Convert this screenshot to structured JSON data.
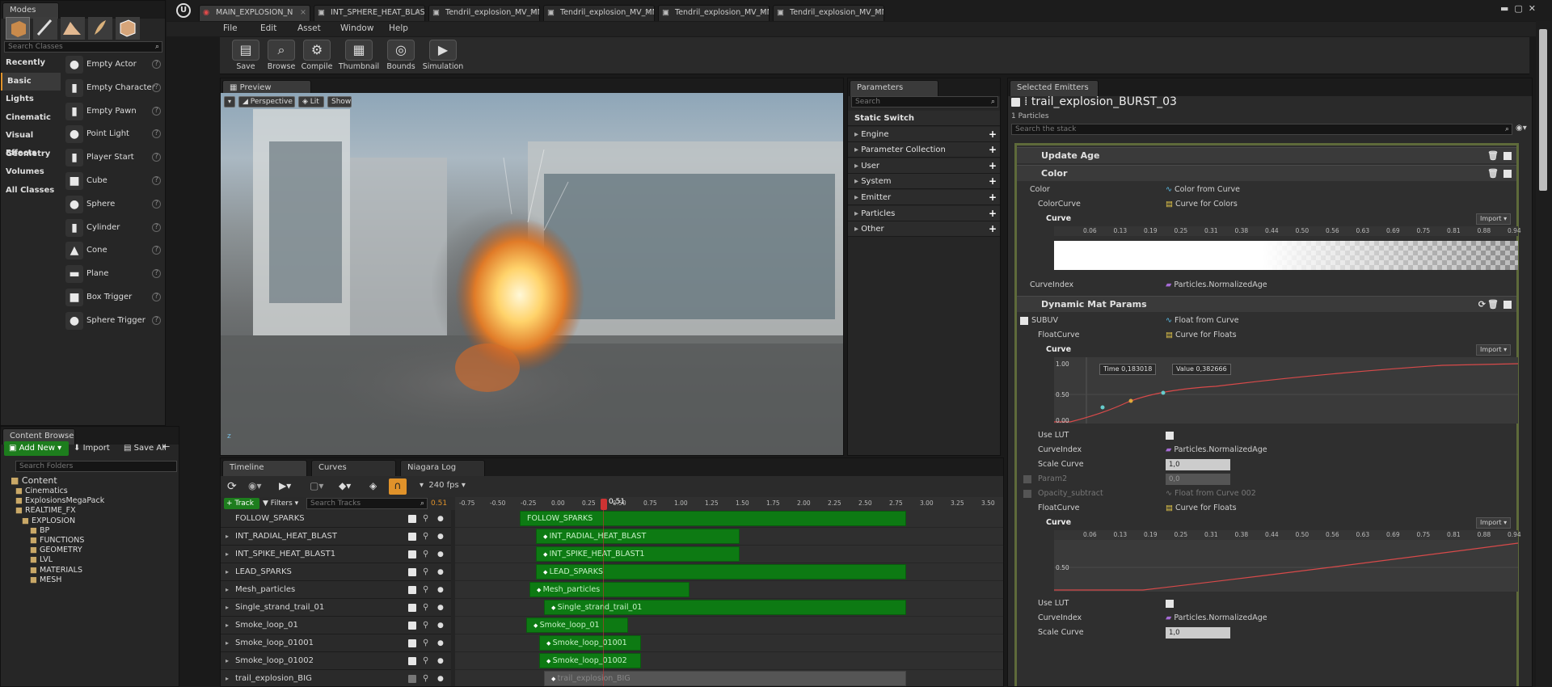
{
  "modes": {
    "title": "Modes",
    "search_placeholder": "Search Classes",
    "categories": [
      "Recently Placed",
      "Basic",
      "Lights",
      "Cinematic",
      "Visual Effects",
      "Geometry",
      "Volumes",
      "All Classes"
    ],
    "items": [
      "Empty Actor",
      "Empty Character",
      "Empty Pawn",
      "Point Light",
      "Player Start",
      "Cube",
      "Sphere",
      "Cylinder",
      "Cone",
      "Plane",
      "Box Trigger",
      "Sphere Trigger"
    ]
  },
  "content_browser": {
    "title": "Content Browser",
    "add_new": "Add New",
    "import": "Import",
    "save_all": "Save All",
    "search_placeholder": "Search Folders",
    "root": "Content",
    "folders": [
      "Cinematics",
      "ExplosionsMegaPack",
      "REALTIME_FX",
      "EXPLOSION",
      "BP",
      "FUNCTIONS",
      "GEOMETRY",
      "LVL",
      "MATERIALS",
      "MESH"
    ]
  },
  "tabs": [
    "MAIN_EXPLOSION_N",
    "INT_SPHERE_HEAT_BLAS",
    "Tendril_explosion_MV_MN",
    "Tendril_explosion_MV_MN",
    "Tendril_explosion_MV_MN",
    "Tendril_explosion_MV_MN"
  ],
  "menu": [
    "File",
    "Edit",
    "Asset",
    "Window",
    "Help"
  ],
  "toolbar": [
    "Save",
    "Browse",
    "Compile",
    "Thumbnail",
    "Bounds",
    "Simulation"
  ],
  "preview": {
    "tab": "Preview",
    "perspective": "Perspective",
    "lit": "Lit",
    "show": "Show",
    "axis_z": "z"
  },
  "parameters": {
    "tab": "Parameters",
    "search_placeholder": "Search",
    "items": [
      "Static Switch",
      "Engine",
      "Parameter Collection",
      "User",
      "System",
      "Emitter",
      "Particles",
      "Other"
    ]
  },
  "timeline": {
    "tabs": [
      "Timeline",
      "Curves",
      "Niagara Log"
    ],
    "fps": "240 fps",
    "track_button": "Track",
    "filters_button": "Filters",
    "search_placeholder": "Search Tracks",
    "time_value": "0.51",
    "playhead_label": "0,51",
    "ticks": [
      "-0.75",
      "-0.50",
      "-0.25",
      "0.00",
      "0.25",
      "0.50",
      "0.75",
      "1.00",
      "1.25",
      "1.50",
      "1.75",
      "2.00",
      "2.25",
      "2.50",
      "2.75",
      "3.00",
      "3.25",
      "3.50"
    ],
    "tracks": [
      "FOLLOW_SPARKS",
      "INT_RADIAL_HEAT_BLAST",
      "INT_SPIKE_HEAT_BLAST1",
      "LEAD_SPARKS",
      "Mesh_particles",
      "Single_strand_trail_01",
      "Smoke_loop_01",
      "Smoke_loop_01001",
      "Smoke_loop_01002",
      "trail_explosion_BIG"
    ],
    "bars": [
      "FOLLOW_SPARKS",
      "INT_RADIAL_HEAT_BLAST",
      "INT_SPIKE_HEAT_BLAST1",
      "LEAD_SPARKS",
      "Mesh_particles",
      "Single_strand_trail_01",
      "Smoke_loop_01",
      "Smoke_loop_01001",
      "Smoke_loop_01002",
      "trail_explosion_BIG"
    ]
  },
  "selected_emitters": {
    "tab": "Selected Emitters",
    "name": "trail_explosion_BURST_03",
    "count": "1 Particles",
    "search_placeholder": "Search the stack",
    "update_age": "Update Age",
    "color": {
      "title": "Color",
      "rows": [
        {
          "label": "Color",
          "value": "Color from Curve"
        },
        {
          "label": "ColorCurve",
          "value": "Curve for Colors"
        },
        {
          "label": "Curve",
          "value": ""
        },
        {
          "label": "CurveIndex",
          "value": "Particles.NormalizedAge"
        }
      ],
      "import": "Import"
    },
    "curve_ticks": [
      "0.06",
      "0.13",
      "0.19",
      "0.25",
      "0.31",
      "0.38",
      "0.44",
      "0.50",
      "0.56",
      "0.63",
      "0.69",
      "0.75",
      "0.81",
      "0.88",
      "0.94"
    ],
    "dyn": {
      "title": "Dynamic Mat Params",
      "subuv": "SUBUV",
      "subuv_value": "Float from Curve",
      "floatcurve": "FloatCurve",
      "floatcurve_value": "Curve for Floats",
      "curve": "Curve",
      "import": "Import",
      "time_label": "Time",
      "time_value": "0,183018",
      "value_label": "Value",
      "value_value": "0,382666",
      "y_labels": [
        "1.00",
        "0.50",
        "0.00"
      ],
      "use_lut": "Use LUT",
      "curve_index": "CurveIndex",
      "curve_index_value": "Particles.NormalizedAge",
      "scale_curve": "Scale Curve",
      "scale_curve_value": "1,0",
      "param2": "Param2",
      "param2_value": "0,0",
      "opacity": "Opacity_subtract",
      "opacity_value": "Float from Curve 002",
      "floatcurve2": "FloatCurve",
      "floatcurve2_value": "Curve for Floats",
      "curve2": "Curve",
      "import2": "Import",
      "y_label2": "0.50",
      "use_lut2": "Use LUT",
      "curve_index2": "CurveIndex",
      "curve_index2_value": "Particles.NormalizedAge",
      "scale_curve2": "Scale Curve",
      "scale_curve2_value": "1,0"
    }
  }
}
